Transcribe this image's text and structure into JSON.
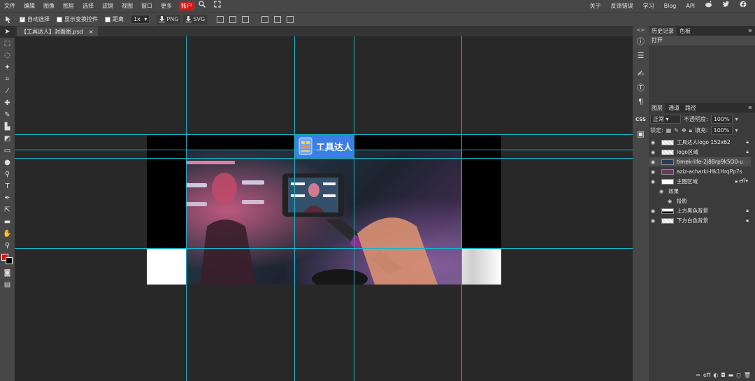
{
  "menu": {
    "items": [
      "文件",
      "编辑",
      "图像",
      "图层",
      "选择",
      "滤镜",
      "视图",
      "窗口",
      "更多"
    ],
    "account": "账户",
    "right_items": [
      "关于",
      "反馈错误",
      "学习",
      "Blog",
      "API"
    ]
  },
  "options": {
    "auto_select": "自动选择",
    "show_transform": "显示变换控件",
    "distance": "距离",
    "zoom": "1x",
    "png": "PNG",
    "svg": "SVG"
  },
  "document": {
    "tab_title": "【工具达人】封面图.psd",
    "close": "×"
  },
  "canvas": {
    "logo_text": "工具达人"
  },
  "right_strip": {
    "css_label": "CSS"
  },
  "history_panel": {
    "tabs": [
      "历史记录",
      "色板"
    ],
    "items": [
      "打开"
    ]
  },
  "layers_panel": {
    "tabs": [
      "图层",
      "通道",
      "路径"
    ],
    "blend_mode": "正常",
    "opacity_label": "不透明度:",
    "opacity_value": "100%",
    "lock_label": "锁定:",
    "fill_label": "填充:",
    "fill_value": "100%",
    "layers": [
      {
        "name": "工具达人logo 152x62"
      },
      {
        "name": "logo区域"
      },
      {
        "name": "timek-life-2j8Brp9k5O0-u"
      },
      {
        "name": "aziz-acharki-Hk1HrqPp7s"
      },
      {
        "name": "主图区域"
      },
      {
        "name": "效果"
      },
      {
        "name": "投影"
      },
      {
        "name": "上方黑色背景"
      },
      {
        "name": "下方白色背景"
      }
    ],
    "eff_label": "eff"
  },
  "colors": {
    "guide": "#16b5c7",
    "account": "#d01818",
    "foreground": "#ff0000",
    "background": "#000000",
    "logo_bg": "#3b7ee8"
  }
}
